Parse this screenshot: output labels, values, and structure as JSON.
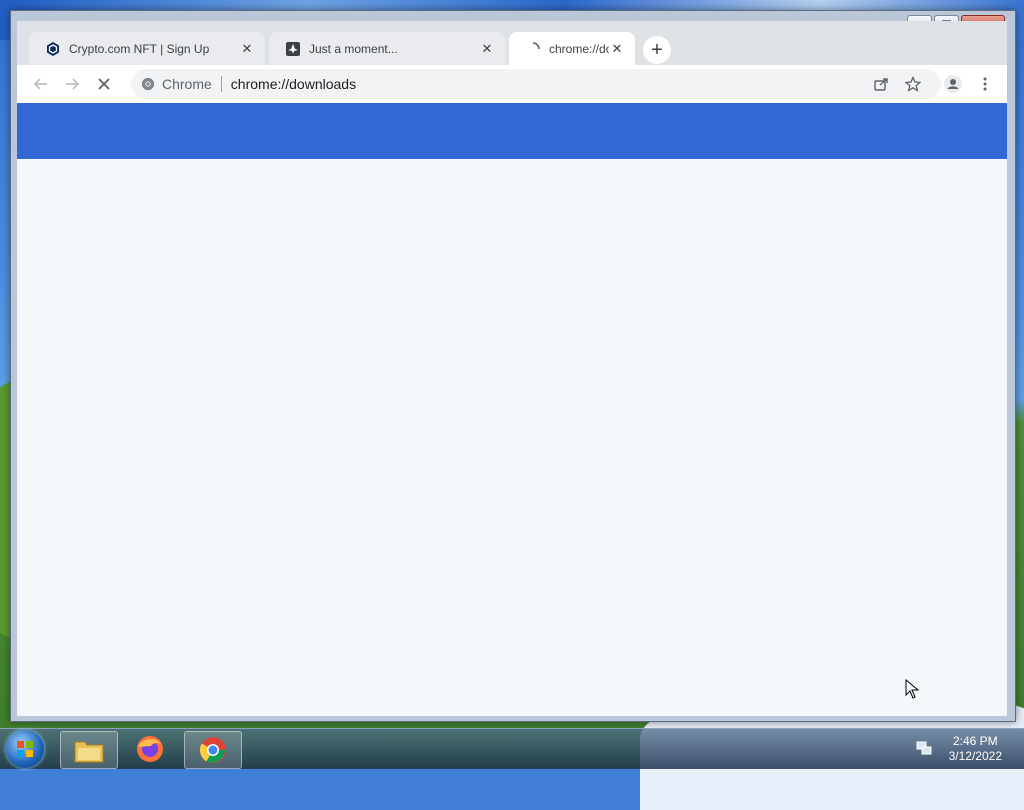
{
  "window": {
    "controls": {
      "minimize": "—",
      "maximize": "☐",
      "close": "✕"
    }
  },
  "tabs": [
    {
      "title": "Crypto.com NFT | Sign Up",
      "icon": "crypto-com-icon",
      "active": false
    },
    {
      "title": "Just a moment...",
      "icon": "site-favicon-icon",
      "active": false
    },
    {
      "title": "chrome://downloads",
      "icon": "loading-icon",
      "active": true
    }
  ],
  "toolbar": {
    "back_icon": "back-arrow-icon",
    "forward_icon": "forward-arrow-icon",
    "stop_icon": "stop-icon",
    "site_label": "Chrome",
    "url": "chrome://downloads"
  },
  "page": {
    "header_color": "#3367d6",
    "background": "#f5f8fb"
  },
  "taskbar": {
    "apps": [
      "windows-explorer-icon",
      "firefox-icon",
      "chrome-icon"
    ],
    "clock_time": "2:46 PM",
    "clock_date": "3/12/2022"
  }
}
